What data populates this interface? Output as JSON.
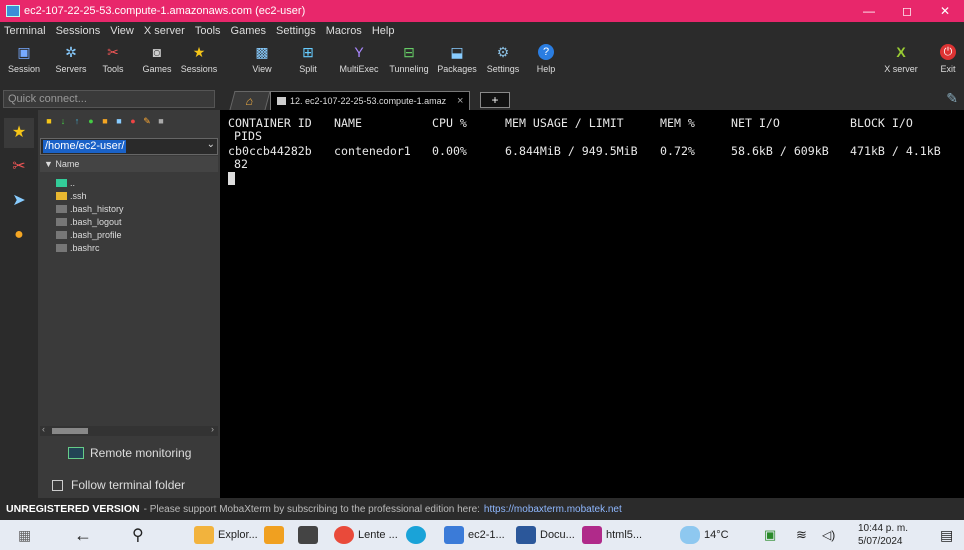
{
  "window": {
    "title": "ec2-107-22-25-53.compute-1.amazonaws.com (ec2-user)",
    "controls": [
      "—",
      "◻",
      "✕"
    ]
  },
  "menu": [
    "Terminal",
    "Sessions",
    "View",
    "X server",
    "Tools",
    "Games",
    "Settings",
    "Macros",
    "Help"
  ],
  "toolbar": {
    "session": "Session",
    "servers": "Servers",
    "tools": "Tools",
    "games": "Games",
    "sessions": "Sessions",
    "view": "View",
    "split": "Split",
    "multiexec": "MultiExec",
    "tunneling": "Tunneling",
    "packages": "Packages",
    "settings": "Settings",
    "help": "Help",
    "xserver": "X server",
    "exit": "Exit"
  },
  "quick_connect": {
    "placeholder": "Quick connect..."
  },
  "tabs": {
    "session_label": "12. ec2-107-22-25-53.compute-1.amaz",
    "close": "×",
    "new": "+"
  },
  "sidebar": {
    "path": "/home/ec2-user/",
    "column": "Name",
    "files": [
      "..",
      ".ssh",
      ".bash_history",
      ".bash_logout",
      ".bash_profile",
      ".bashrc"
    ],
    "remote_monitoring": "Remote monitoring",
    "follow_folder": "Follow terminal folder"
  },
  "terminal": {
    "headers": [
      "CONTAINER ID",
      "NAME",
      "CPU %",
      "MEM USAGE / LIMIT",
      "MEM %",
      "NET I/O",
      "BLOCK I/O"
    ],
    "header_pids": "PIDS",
    "row": {
      "container_id": "cb0ccb44282b",
      "name": "contenedor1",
      "cpu": "0.00%",
      "mem_usage": "6.844MiB / 949.5MiB",
      "mem_pct": "0.72%",
      "net_io": "58.6kB / 609kB",
      "block_io": "471kB / 4.1kB",
      "pids": "82"
    }
  },
  "status": {
    "unregistered": "UNREGISTERED VERSION",
    "message": "-  Please support MobaXterm by subscribing to the professional edition here:",
    "url": "https://mobaxterm.mobatek.net"
  },
  "taskbar": {
    "apps": [
      {
        "label": "Explor...",
        "color": "#f2b33d"
      },
      {
        "label": "",
        "color": "#f0a020"
      },
      {
        "label": "",
        "color": "#444"
      },
      {
        "label": "Lente ...",
        "color": "#e94a3a"
      },
      {
        "label": "",
        "color": "#1aa3d8"
      },
      {
        "label": "ec2-1...",
        "color": "#3b7bd8"
      },
      {
        "label": "Docu...",
        "color": "#2b579a"
      },
      {
        "label": "html5...",
        "color": "#b02a8a"
      }
    ],
    "weather": "14°C",
    "time": "10:44 p. m.",
    "date": "5/07/2024"
  },
  "colors": {
    "titlebar": "#e8276b",
    "chrome": "#2b2b2b",
    "path_highlight": "#1a62c8"
  }
}
